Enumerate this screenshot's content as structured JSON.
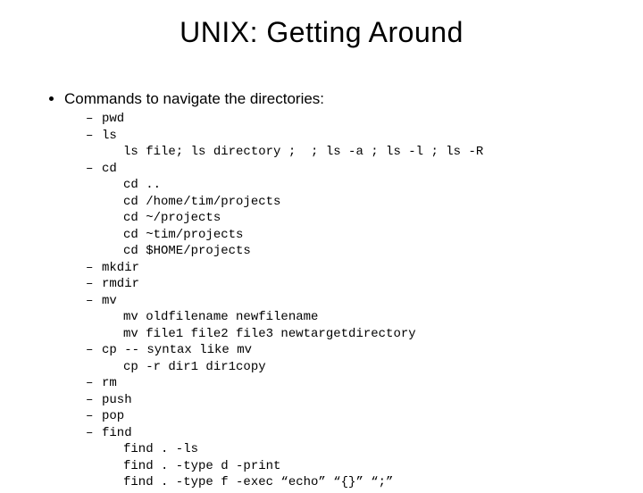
{
  "title": "UNIX: Getting Around",
  "main_bullet": "Commands to navigate the directories:",
  "commands": [
    {
      "label": "pwd"
    },
    {
      "label": "ls",
      "sub": [
        "ls file; ls directory ;  ; ls -a ; ls -l ; ls -R"
      ]
    },
    {
      "label": "cd",
      "sub": [
        "cd ..",
        "cd /home/tim/projects",
        "cd ~/projects",
        "cd ~tim/projects",
        "cd $HOME/projects"
      ]
    },
    {
      "label": "mkdir"
    },
    {
      "label": "rmdir"
    },
    {
      "label": "mv",
      "sub": [
        "mv oldfilename newfilename",
        "mv file1 file2 file3 newtargetdirectory"
      ]
    },
    {
      "label": "cp    -- syntax like mv",
      "sub": [
        "cp -r dir1 dir1copy"
      ]
    },
    {
      "label": "rm"
    },
    {
      "label": "push"
    },
    {
      "label": "pop"
    },
    {
      "label": "find",
      "sub": [
        "find . -ls",
        "find . -type d -print",
        "find . -type f -exec “echo” “{}” “;”"
      ]
    }
  ]
}
